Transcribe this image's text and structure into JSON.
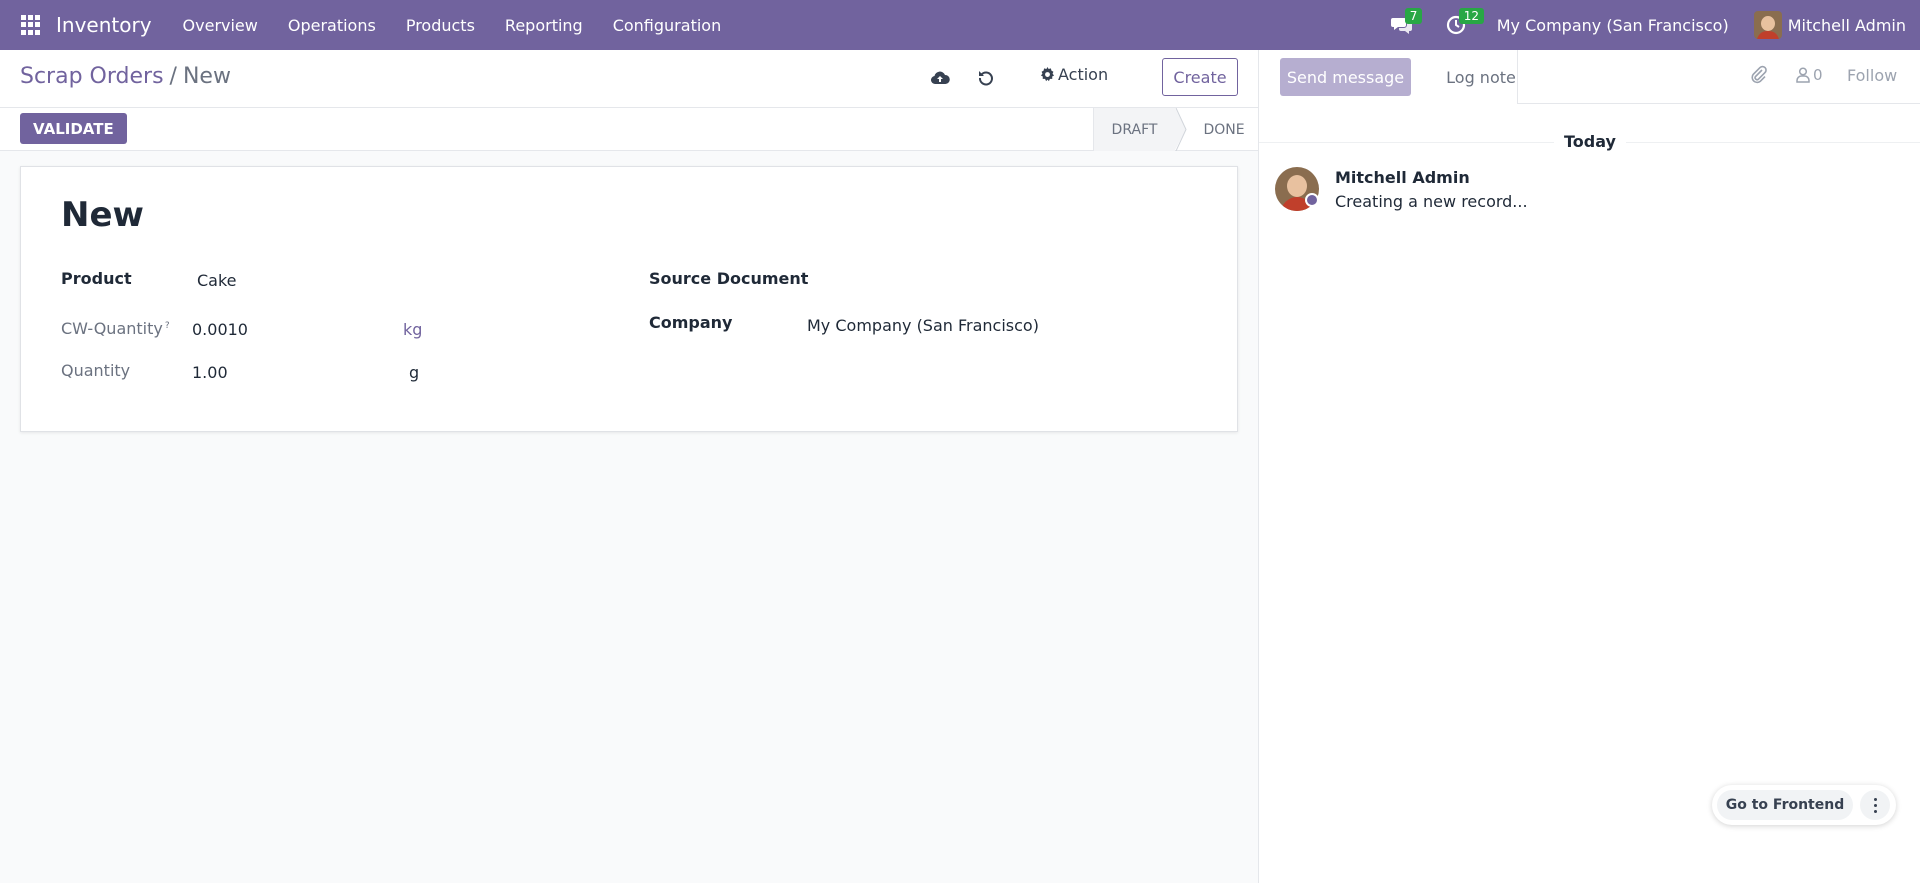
{
  "navbar": {
    "app_name": "Inventory",
    "menu": [
      "Overview",
      "Operations",
      "Products",
      "Reporting",
      "Configuration"
    ],
    "messages_count": "7",
    "activities_count": "12",
    "company": "My Company (San Francisco)",
    "user": "Mitchell Admin",
    "badge_color": "#28a745",
    "brand_color": "#71639e"
  },
  "breadcrumb": {
    "parent": "Scrap Orders",
    "separator": "/",
    "current": "New"
  },
  "control": {
    "action_label": "Action",
    "create_label": "Create",
    "icons": [
      "cloud-upload-icon",
      "undo-icon",
      "gear-icon"
    ]
  },
  "statusbar": {
    "validate_label": "VALIDATE",
    "stages": [
      "DRAFT",
      "DONE"
    ],
    "current_stage": "DRAFT"
  },
  "form": {
    "title": "New",
    "product_label": "Product",
    "product_value": "Cake",
    "cw_quantity_label": "CW-Quantity",
    "cw_quantity_help": "?",
    "cw_quantity_value": "0.0010",
    "cw_quantity_uom": "kg",
    "quantity_label": "Quantity",
    "quantity_value": "1.00",
    "quantity_uom": "g",
    "source_document_label": "Source Document",
    "company_label": "Company",
    "company_value": "My Company (San Francisco)"
  },
  "chatter": {
    "send_message_label": "Send message",
    "log_note_label": "Log note",
    "followers_count": "0",
    "follow_label": "Follow",
    "date_separator": "Today",
    "messages": [
      {
        "author": "Mitchell Admin",
        "body": "Creating a new record..."
      }
    ]
  },
  "frontend": {
    "label": "Go to Frontend"
  }
}
